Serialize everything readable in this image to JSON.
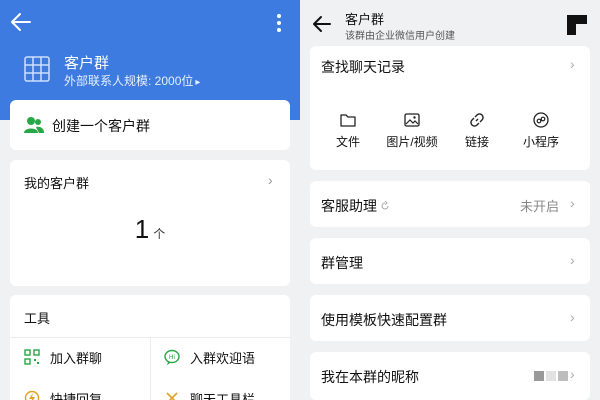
{
  "left": {
    "hero": {
      "title": "客户群",
      "subtitle": "外部联系人规模: 2000位"
    },
    "create_label": "创建一个客户群",
    "my_groups": {
      "title": "我的客户群",
      "count": "1",
      "unit": "个"
    },
    "tools": {
      "title": "工具",
      "items": [
        {
          "label": "加入群聊",
          "icon": "qr-code-icon"
        },
        {
          "label": "入群欢迎语",
          "icon": "welcome-message-icon"
        },
        {
          "label": "快捷回复",
          "icon": "quick-reply-icon"
        },
        {
          "label": "聊天工具栏",
          "icon": "toolbar-icon"
        }
      ]
    }
  },
  "right": {
    "header": {
      "title": "客户群",
      "subtitle": "该群由企业微信用户创建"
    },
    "history": {
      "title": "查找聊天记录",
      "items": [
        {
          "label": "文件",
          "icon": "folder-icon"
        },
        {
          "label": "图片/视频",
          "icon": "image-icon"
        },
        {
          "label": "链接",
          "icon": "link-icon"
        },
        {
          "label": "小程序",
          "icon": "mini-program-icon"
        }
      ]
    },
    "assistant": {
      "label": "客服助理",
      "value": "未开启"
    },
    "manage_label": "群管理",
    "template_label": "使用模板快速配置群",
    "nickname_label": "我在本群的昵称"
  },
  "colors": {
    "brand_blue": "#3d7be0",
    "green_accent": "#27a745",
    "background": "#f0f1f3"
  }
}
